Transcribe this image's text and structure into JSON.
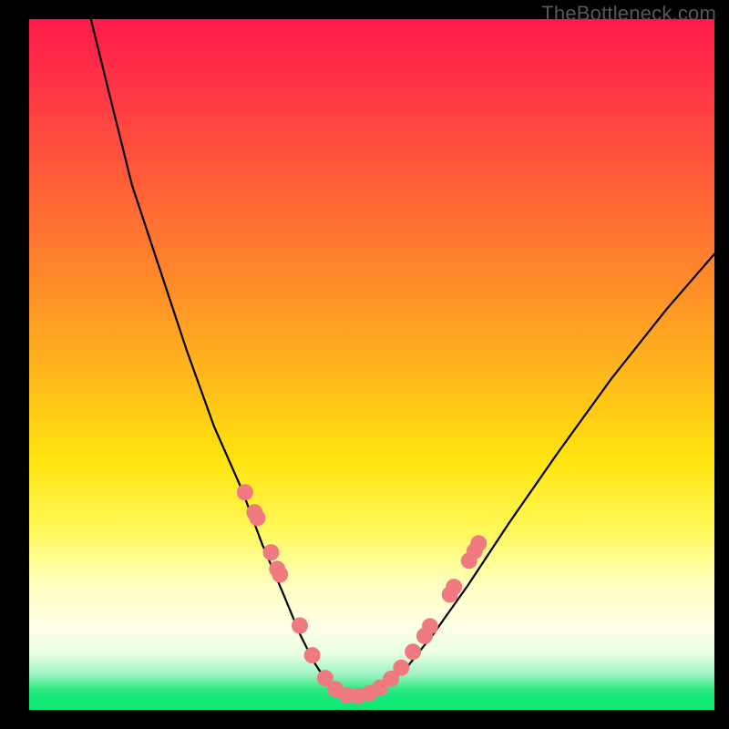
{
  "watermark": "TheBottleneck.com",
  "chart_data": {
    "type": "line",
    "title": "",
    "xlabel": "",
    "ylabel": "",
    "xlim": [
      0,
      100
    ],
    "ylim": [
      0,
      100
    ],
    "series": [
      {
        "name": "bottleneck-curve",
        "x": [
          9,
          12,
          15,
          19,
          23,
          27,
          31,
          34,
          37,
          39.5,
          41.5,
          43.5,
          45.5,
          47.5,
          49,
          52,
          55,
          59,
          64,
          70,
          77,
          85,
          93,
          100
        ],
        "y": [
          100,
          88,
          76,
          64,
          52,
          41,
          32,
          24,
          17,
          11,
          7,
          4,
          2.3,
          2.0,
          2.1,
          3.5,
          6,
          11,
          18,
          27,
          37,
          48,
          58,
          66
        ]
      }
    ],
    "markers": [
      {
        "name": "left-cluster",
        "color": "#ef7a7f",
        "points": [
          {
            "x": 31.5,
            "y": 31.5
          },
          {
            "x": 32.9,
            "y": 28.6
          },
          {
            "x": 33.3,
            "y": 27.8
          },
          {
            "x": 35.3,
            "y": 22.8
          },
          {
            "x": 36.2,
            "y": 20.4
          },
          {
            "x": 36.6,
            "y": 19.6
          },
          {
            "x": 39.5,
            "y": 12.2
          },
          {
            "x": 41.3,
            "y": 7.9
          }
        ]
      },
      {
        "name": "valley-cluster",
        "color": "#ef7a7f",
        "points": [
          {
            "x": 43.2,
            "y": 4.6
          },
          {
            "x": 44.7,
            "y": 3.0
          },
          {
            "x": 46.4,
            "y": 2.1
          },
          {
            "x": 48.0,
            "y": 2.0
          },
          {
            "x": 49.7,
            "y": 2.4
          },
          {
            "x": 51.2,
            "y": 3.2
          },
          {
            "x": 52.8,
            "y": 4.5
          },
          {
            "x": 54.3,
            "y": 6.1
          }
        ]
      },
      {
        "name": "right-cluster",
        "color": "#ef7a7f",
        "points": [
          {
            "x": 56.0,
            "y": 8.4
          },
          {
            "x": 57.7,
            "y": 10.7
          },
          {
            "x": 58.5,
            "y": 12.1
          },
          {
            "x": 61.4,
            "y": 16.7
          },
          {
            "x": 62.0,
            "y": 17.8
          },
          {
            "x": 64.2,
            "y": 21.6
          },
          {
            "x": 65.0,
            "y": 23.0
          },
          {
            "x": 65.6,
            "y": 24.1
          }
        ]
      }
    ]
  }
}
